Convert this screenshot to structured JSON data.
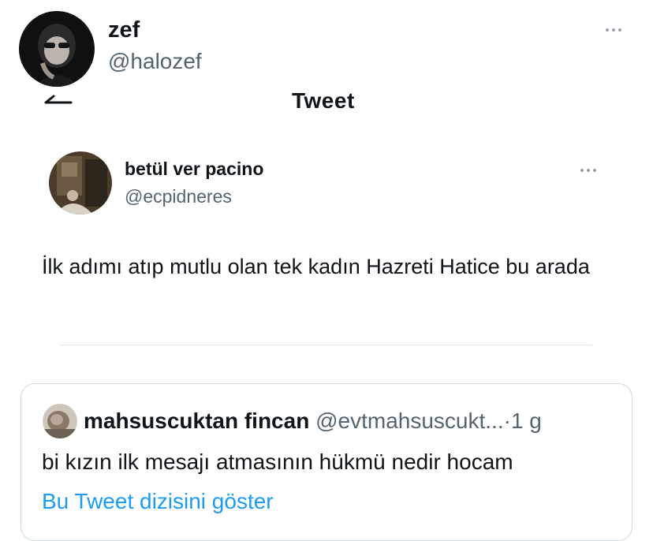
{
  "header": {
    "name": "zef",
    "handle": "@halozef"
  },
  "nav": {
    "back_icon": "arrow-left-icon",
    "title": "Tweet"
  },
  "tweet": {
    "name": "betül ver pacino",
    "handle": "@ecpidneres",
    "text": "İlk adımı atıp mutlu olan tek kadın Hazreti Hatice bu arada"
  },
  "quote": {
    "name": "mahsuscuktan fincan",
    "handle": "@evtmahsuscukt...",
    "separator": "·",
    "time": "1 g",
    "text": "bi kızın ilk mesajı atmasının hükmü nedir hocam",
    "show_thread": "Bu Tweet dizisini göster"
  },
  "colors": {
    "link": "#1d9bf0",
    "secondary_text": "#536471",
    "border": "#cfd9de"
  }
}
